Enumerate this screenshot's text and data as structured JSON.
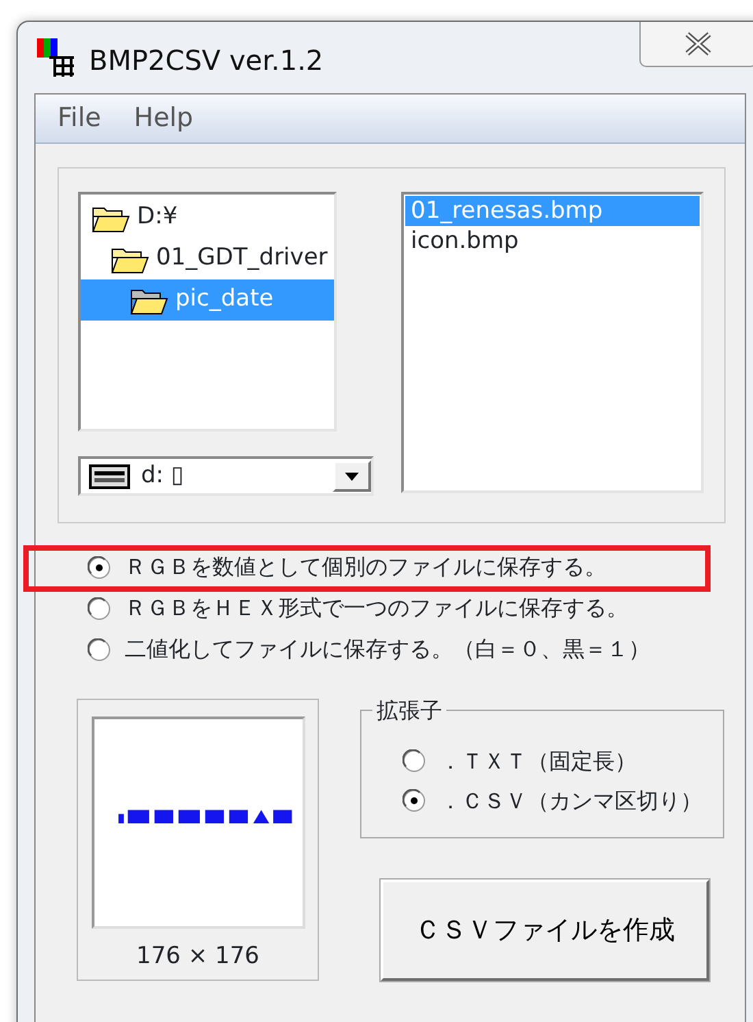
{
  "window": {
    "title": "BMP2CSV ver.1.2"
  },
  "menu": [
    {
      "label": "File"
    },
    {
      "label": "Help"
    }
  ],
  "folders": [
    {
      "label": "D:¥",
      "selected": false,
      "children": [
        {
          "label": "01_GDT_driver",
          "selected": false,
          "children": [
            {
              "label": "pic_date",
              "selected": true
            }
          ]
        }
      ]
    }
  ],
  "drive": {
    "value": "d: ▯"
  },
  "files": [
    {
      "label": "01_renesas.bmp",
      "selected": true
    },
    {
      "label": "icon.bmp",
      "selected": false
    }
  ],
  "modes": [
    {
      "label": "ＲＧＢを数値として個別のファイルに保存する。",
      "selected": true,
      "highlighted": true
    },
    {
      "label": "ＲＧＢをＨＥＸ形式で一つのファイルに保存する。",
      "selected": false,
      "highlighted": false
    },
    {
      "label": "二値化してファイルに保存する。（白＝０、黒＝１）",
      "selected": false,
      "highlighted": false
    }
  ],
  "preview": {
    "kind": "picture",
    "size": "176 × 176"
  },
  "extension": {
    "title": "拡張子",
    "options": [
      {
        "label": "．ＴＸＴ（固定長）",
        "selected": false
      },
      {
        "label": "．ＣＳＶ（カンマ区切り）",
        "selected": true
      }
    ]
  },
  "create_button": {
    "label": "ＣＳＶファイルを作成"
  }
}
